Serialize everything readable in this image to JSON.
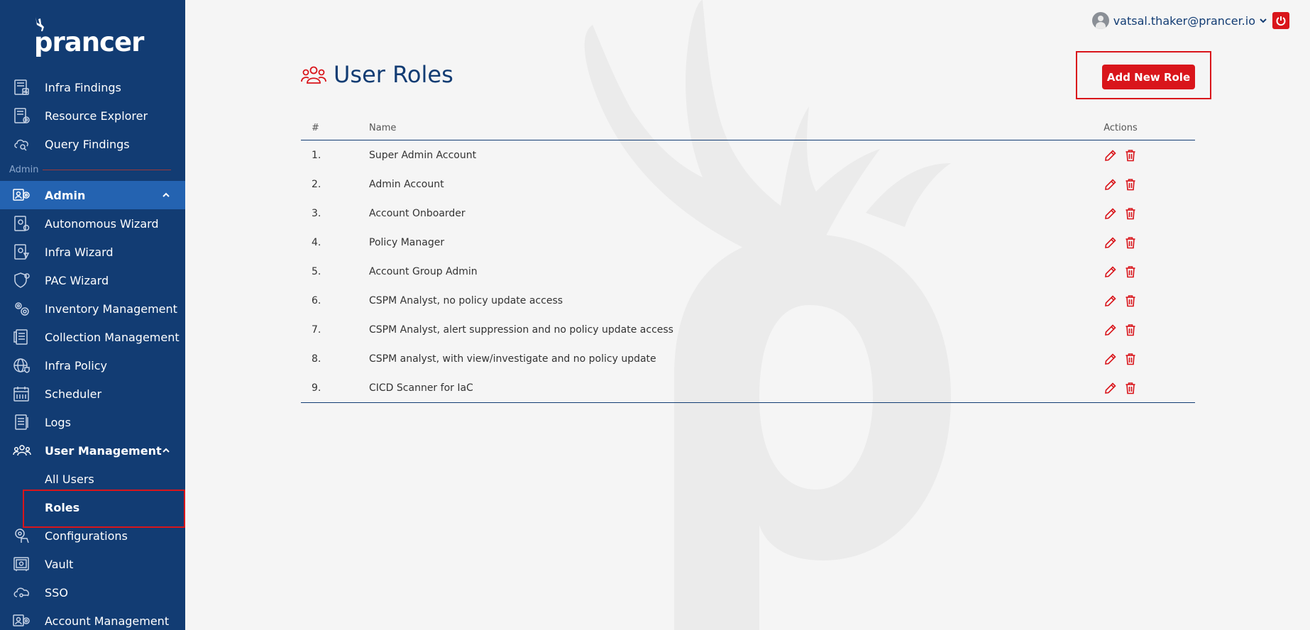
{
  "brand": {
    "name": "prancer"
  },
  "sidebar": {
    "items_top": [
      {
        "label": "Infra Findings",
        "icon": "report-icon"
      },
      {
        "label": "Resource Explorer",
        "icon": "resource-icon"
      },
      {
        "label": "Query Findings",
        "icon": "cloud-query-icon"
      }
    ],
    "section_label": "Admin",
    "admin": {
      "label": "Admin",
      "icon": "admin-icon"
    },
    "items_admin": [
      {
        "label": "Autonomous Wizard",
        "icon": "wizard-icon"
      },
      {
        "label": "Infra Wizard",
        "icon": "wizard-icon"
      },
      {
        "label": "PAC Wizard",
        "icon": "shield-icon"
      },
      {
        "label": "Inventory Management",
        "icon": "gears-icon"
      },
      {
        "label": "Collection Management",
        "icon": "collection-icon"
      },
      {
        "label": "Infra Policy",
        "icon": "globe-icon"
      },
      {
        "label": "Scheduler",
        "icon": "calendar-icon"
      },
      {
        "label": "Logs",
        "icon": "logs-icon"
      }
    ],
    "user_management": {
      "label": "User Management",
      "icon": "users-icon"
    },
    "user_management_sub": [
      {
        "label": "All Users"
      },
      {
        "label": "Roles"
      }
    ],
    "items_bottom": [
      {
        "label": "Configurations",
        "icon": "gear-hand-icon"
      },
      {
        "label": "Vault",
        "icon": "vault-icon"
      },
      {
        "label": "SSO",
        "icon": "cloud-key-icon"
      },
      {
        "label": "Account Management",
        "icon": "account-gear-icon"
      }
    ]
  },
  "topbar": {
    "user_email": "vatsal.thaker@prancer.io"
  },
  "page": {
    "title": "User Roles",
    "add_button": "Add New Role"
  },
  "table": {
    "headers": {
      "num": "#",
      "name": "Name",
      "actions": "Actions"
    },
    "rows": [
      {
        "num": "1.",
        "name": "Super Admin Account"
      },
      {
        "num": "2.",
        "name": "Admin Account"
      },
      {
        "num": "3.",
        "name": "Account Onboarder"
      },
      {
        "num": "4.",
        "name": "Policy Manager"
      },
      {
        "num": "5.",
        "name": "Account Group Admin"
      },
      {
        "num": "6.",
        "name": "CSPM Analyst, no policy update access"
      },
      {
        "num": "7.",
        "name": "CSPM Analyst, alert suppression and no policy update access"
      },
      {
        "num": "8.",
        "name": "CSPM analyst, with view/investigate and no policy update"
      },
      {
        "num": "9.",
        "name": "CICD Scanner for IaC"
      }
    ]
  },
  "colors": {
    "sidebar_bg": "#123c73",
    "active_bg": "#2463b1",
    "accent_red": "#d9151b",
    "title_blue": "#123c73"
  }
}
